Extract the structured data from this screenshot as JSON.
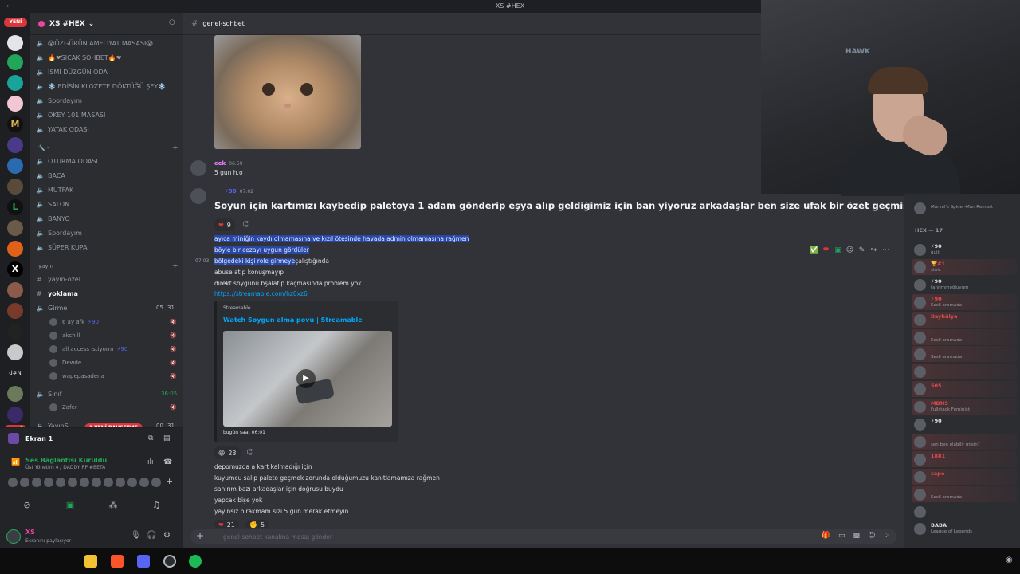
{
  "window": {
    "title": "XS #HEX",
    "back": "←"
  },
  "rail": {
    "new_top": "YENİ",
    "new_bottom": "YENİ",
    "letters": [
      "M",
      "L",
      "X",
      "d#N"
    ]
  },
  "guild": {
    "name": "XS #HEX",
    "chevron": "⌄",
    "invite_icon": "person-add-icon"
  },
  "channels_top": [
    "😱ÖZGÜRÜN AMELİYAT MASASI😱",
    "🔥❤SICAK SOHBET🔥❤",
    "İSMİ DÜZGÜN ODA",
    "❄️ EDİSİN KLOZETE DÖKTÜĞÜ ŞEY❄️",
    "Spordayım",
    "OKEY 101 MASASI",
    "YATAK ODASI"
  ],
  "category_tools": {
    "label": "🔧 -"
  },
  "channels_mid": [
    "OTURMA ODASI",
    "BACA",
    "MUTFAK",
    "SALON",
    "BANYO",
    "Spordayım",
    "SÜPER KUPA"
  ],
  "category_yayin": {
    "label": "yayın"
  },
  "text_channels": [
    "yayin-özel",
    "yoklama"
  ],
  "voice_girme": {
    "label": "Girme",
    "count_a": "05",
    "count_b": "31"
  },
  "girme_users": [
    {
      "name": "6 ay afk",
      "badge": "⚡90"
    },
    {
      "name": "akchill",
      "badge": ""
    },
    {
      "name": "all access istiyorm",
      "badge": "⚡90"
    },
    {
      "name": "Dewde",
      "badge": ""
    },
    {
      "name": "wapepasadena",
      "badge": ""
    }
  ],
  "voice_sinif": {
    "label": "Sınıf",
    "time": "36:05"
  },
  "sinif_users": [
    {
      "name": "Zafer"
    }
  ],
  "voice_yayin": {
    "label": "YayınS",
    "count_a": "00",
    "count_b": "31",
    "new_pill": "1 YENİ BAHSETME"
  },
  "voice_panel": {
    "screen": "Ekran 1",
    "connected": "Ses Bağlantısı Kuruldu",
    "server": "Üst Yönetim 4 / DADDY RP #BETA"
  },
  "user": {
    "name": "XS",
    "status": "Ekranını paylaşıyor"
  },
  "header": {
    "channel": "genel-sohbet"
  },
  "messages": {
    "eek": {
      "author": "eek",
      "time": "06:59",
      "text": "5 gun h.o"
    },
    "big": {
      "author_badge": "⚡90",
      "time": "07:02",
      "text": "Soyun için kartımızı kaybedip paletoya 1 adam gönderip eşya alıp geldiğimiz için ban yiyoruz arkadaşlar ben size ufak bir özet geçmiş olayım."
    },
    "heart_count": "9",
    "hover_time": "07:03",
    "lines_sel": [
      "ayıca miniğin kaydı olmamasına ve kızıl ötesinde havada admin olmamasına rağmen",
      "böyle bir cezayı uygun gördüler"
    ],
    "line_partial_sel": "bölgedeki kişi role girmeye",
    "line_partial_rest": "çalıştığında",
    "lines": [
      "abuse atıp konuşmayıp",
      "direkt soygunu bşalatıp kaçmasında problem yok"
    ],
    "link": "https://streamable.com/hz0xz6",
    "embed": {
      "provider": "Streamable",
      "title": "Watch Soygun alma povu | Streamable",
      "caption": "bugün saat 06:01"
    },
    "laugh_count": "23",
    "lines2": [
      "depomuzda a kart kalmadığı için",
      "kuyumcu salıp paleto geçmek zorunda olduğumuzu kanıtlamamıza rağmen",
      "sanırım bazı arkadaşlar için doğrusu buydu",
      "yapcak bişe yok",
      "yayınsız bırakmam sizi 5 gün merak etmeyin"
    ],
    "bottom_react_a": "21",
    "bottom_react_b": "5"
  },
  "composer": {
    "placeholder": "genel-sohbet kanalına mesaj gönder"
  },
  "webcam": {
    "logo": "HAWK"
  },
  "members": {
    "top_sub": "Marvel's Spider-Man Remast",
    "hex_header": "HEX — 17",
    "list": [
      {
        "name": "⚡90",
        "sub": "quit",
        "color": "#dbdee1"
      },
      {
        "name": "🏆#1",
        "sub": "stoic",
        "color": "#e04a4a"
      },
      {
        "name": "⚡90",
        "sub": "tanrımmoğluyum",
        "color": "#dbdee1"
      },
      {
        "name": "⚡90",
        "sub": "Sesli aramada",
        "color": "#e04a4a"
      },
      {
        "name": "Bayhülya",
        "sub": "",
        "color": "#e04a4a"
      },
      {
        "name": "",
        "sub": "Sesli aramada",
        "color": "#e04a4a"
      },
      {
        "name": "",
        "sub": "Sesli aramada",
        "color": "#e04a4a"
      },
      {
        "name": "",
        "sub": "",
        "color": "#e04a4a"
      },
      {
        "name": "505",
        "sub": "",
        "color": "#e04a4a"
      },
      {
        "name": "MDNS",
        "sub": "Fullstack Feminist",
        "color": "#e04a4a"
      },
      {
        "name": "⚡90",
        "sub": "",
        "color": "#dbdee1"
      },
      {
        "name": "",
        "sub": "sen ben olabilir misin?",
        "color": "#e04a4a"
      },
      {
        "name": "1881",
        "sub": "",
        "color": "#e04a4a"
      },
      {
        "name": "cape",
        "sub": "",
        "color": "#e04a4a"
      },
      {
        "name": "",
        "sub": "Sesli aramada",
        "color": "#e04a4a"
      },
      {
        "name": "",
        "sub": "",
        "color": "#dbdee1"
      },
      {
        "name": "BABA",
        "sub": "League of Legends",
        "color": "#dbdee1"
      }
    ]
  },
  "colors": {
    "accent": "#5865f2",
    "online": "#23a55a",
    "link": "#00a8fc",
    "danger": "#da373c"
  }
}
